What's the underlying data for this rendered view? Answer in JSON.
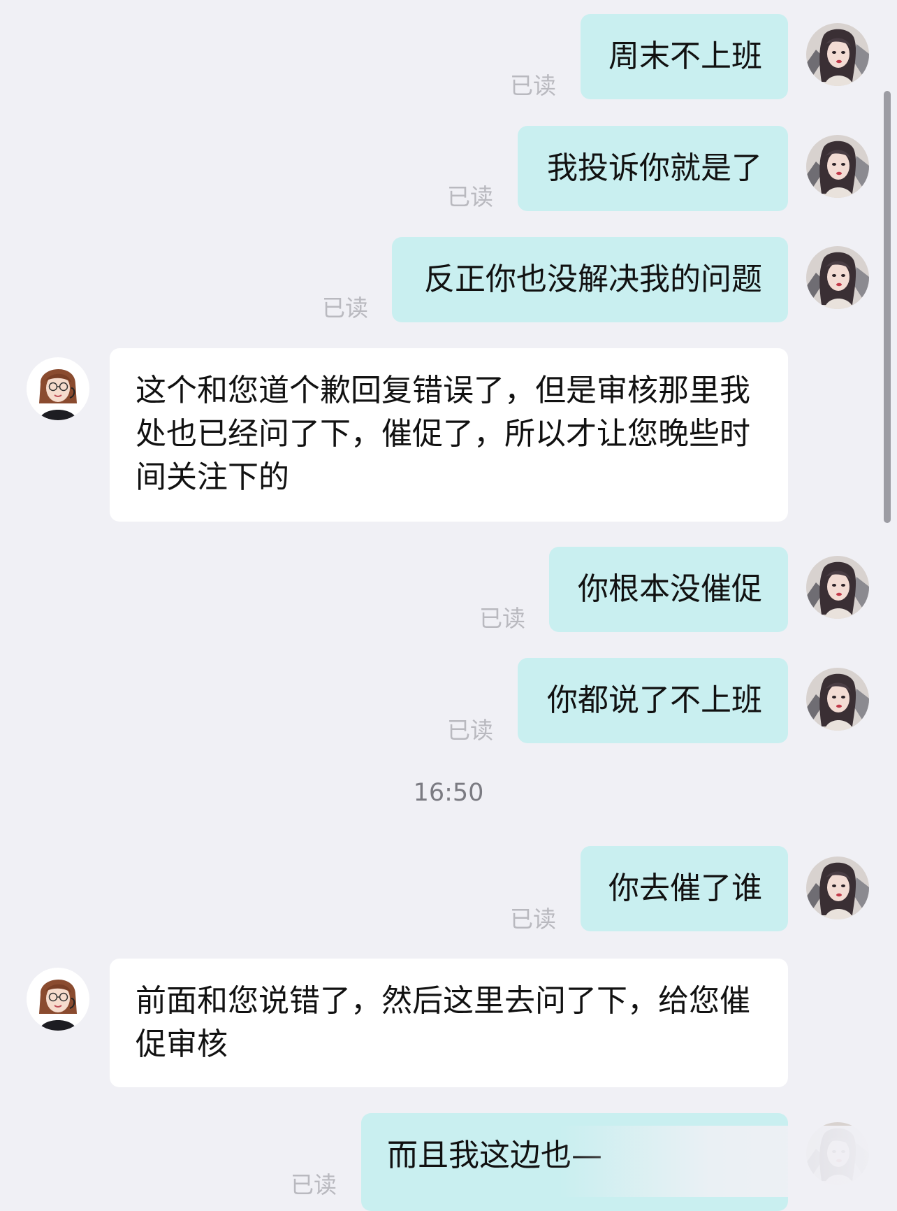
{
  "conversation": {
    "timestamp": "16:50",
    "read_label": "已读",
    "messages": [
      {
        "sender": "me",
        "text": "周末不上班",
        "read": "已读"
      },
      {
        "sender": "me",
        "text": "我投诉你就是了",
        "read": "已读"
      },
      {
        "sender": "me",
        "text": "反正你也没解决我的问题",
        "read": "已读"
      },
      {
        "sender": "agent",
        "text": "这个和您道个歉回复错误了，但是审核那里我处也已经问了下，催促了，所以才让您晚些时间关注下的"
      },
      {
        "sender": "me",
        "text": "你根本没催促",
        "read": "已读"
      },
      {
        "sender": "me",
        "text": "你都说了不上班",
        "read": "已读"
      },
      {
        "sender": "me",
        "text": "你去催了谁",
        "read": "已读"
      },
      {
        "sender": "agent",
        "text": "前面和您说错了，然后这里去问了下，给您催促审核"
      },
      {
        "sender": "me",
        "text": "而且我这边也—",
        "read": "已读"
      }
    ]
  },
  "colors": {
    "background": "#f0f0f5",
    "my_bubble": "#c9eff0",
    "agent_bubble": "#ffffff",
    "read_text": "#b9b9bf",
    "timestamp_text": "#7b7b82"
  },
  "icons": {
    "user_avatar": "user-avatar-icon",
    "agent_avatar": "agent-avatar-icon"
  }
}
